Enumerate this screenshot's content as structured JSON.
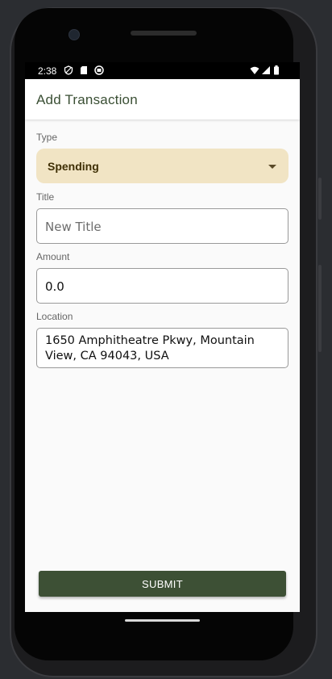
{
  "status_bar": {
    "time": "2:38",
    "icons": [
      "shield-icon",
      "sd-card-icon",
      "app-notification-icon",
      "wifi-icon",
      "cell-signal-icon",
      "battery-icon"
    ]
  },
  "app_bar": {
    "title": "Add Transaction"
  },
  "form": {
    "type": {
      "label": "Type",
      "selected": "Spending"
    },
    "title": {
      "label": "Title",
      "value": "",
      "placeholder": "New Title"
    },
    "amount": {
      "label": "Amount",
      "value": "0.0"
    },
    "location": {
      "label": "Location",
      "value": "1650 Amphitheatre Pkwy, Mountain View, CA 94043, USA"
    },
    "submit_label": "SUBMIT"
  },
  "colors": {
    "accent": "#3d5035",
    "dropdown_bg": "#f1e4c4",
    "title_text": "#3a4f34"
  }
}
